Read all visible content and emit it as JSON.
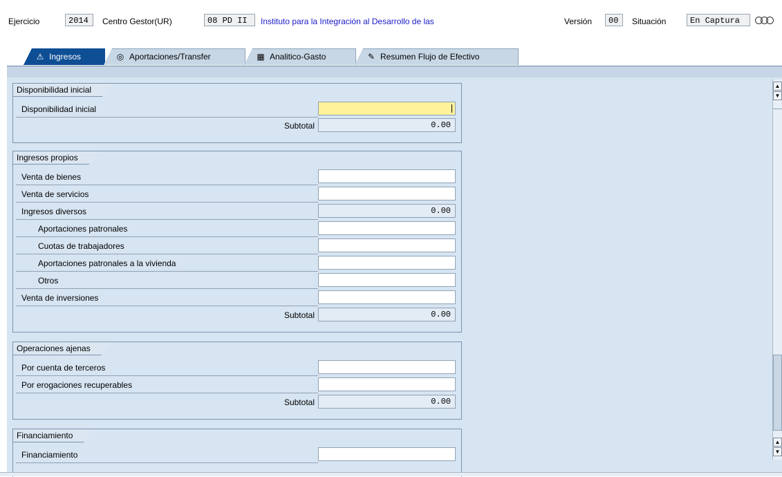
{
  "header": {
    "ejercicio_label": "Ejercicio",
    "ejercicio_value": "2014",
    "centro_label": "Centro Gestor(UR)",
    "centro_value": "08 PD II",
    "centro_desc": "Instituto para la Integración al Desarrollo de las",
    "version_label": "Versión",
    "version_value": "00",
    "situacion_label": "Situación",
    "situacion_value": "En Captura",
    "status_icon": "three-circles-icon"
  },
  "tabs": [
    {
      "label": "Ingresos",
      "icon": "warning-triangle-icon",
      "active": true
    },
    {
      "label": "Aportaciones/Transfer",
      "icon": "coin-icon",
      "active": false
    },
    {
      "label": "Analitico-Gasto",
      "icon": "spreadsheet-icon",
      "active": false
    },
    {
      "label": "Resumen Flujo de Efectivo",
      "icon": "document-edit-icon",
      "active": false
    }
  ],
  "sections": {
    "disponibilidad": {
      "title": "Disponibilidad inicial",
      "rows": [
        {
          "label": "Disponibilidad inicial",
          "value": ""
        }
      ],
      "subtotal_label": "Subtotal",
      "subtotal_value": "0.00"
    },
    "ingresos_propios": {
      "title": "Ingresos propios",
      "rows": [
        {
          "label": "Venta de bienes",
          "value": ""
        },
        {
          "label": "Venta de servicios",
          "value": ""
        },
        {
          "label": "Ingresos diversos",
          "value": "0.00"
        },
        {
          "label": "Aportaciones patronales",
          "value": ""
        },
        {
          "label": "Cuotas de trabajadores",
          "value": ""
        },
        {
          "label": "Aportaciones patronales a la vivienda",
          "value": ""
        },
        {
          "label": "Otros",
          "value": ""
        },
        {
          "label": "Venta de inversiones",
          "value": ""
        }
      ],
      "subtotal_label": "Subtotal",
      "subtotal_value": "0.00"
    },
    "operaciones_ajenas": {
      "title": "Operaciones ajenas",
      "rows": [
        {
          "label": "Por cuenta de terceros",
          "value": ""
        },
        {
          "label": "Por erogaciones recuperables",
          "value": ""
        }
      ],
      "subtotal_label": "Subtotal",
      "subtotal_value": "0.00"
    },
    "financiamiento": {
      "title": "Financiamiento",
      "rows": [
        {
          "label": "Financiamiento",
          "value": ""
        }
      ]
    }
  },
  "colors": {
    "active_tab": "#0d4e95",
    "content_bg": "#d7e4f1",
    "highlight_field": "#fff29b",
    "link_text": "#1a1ac8"
  }
}
